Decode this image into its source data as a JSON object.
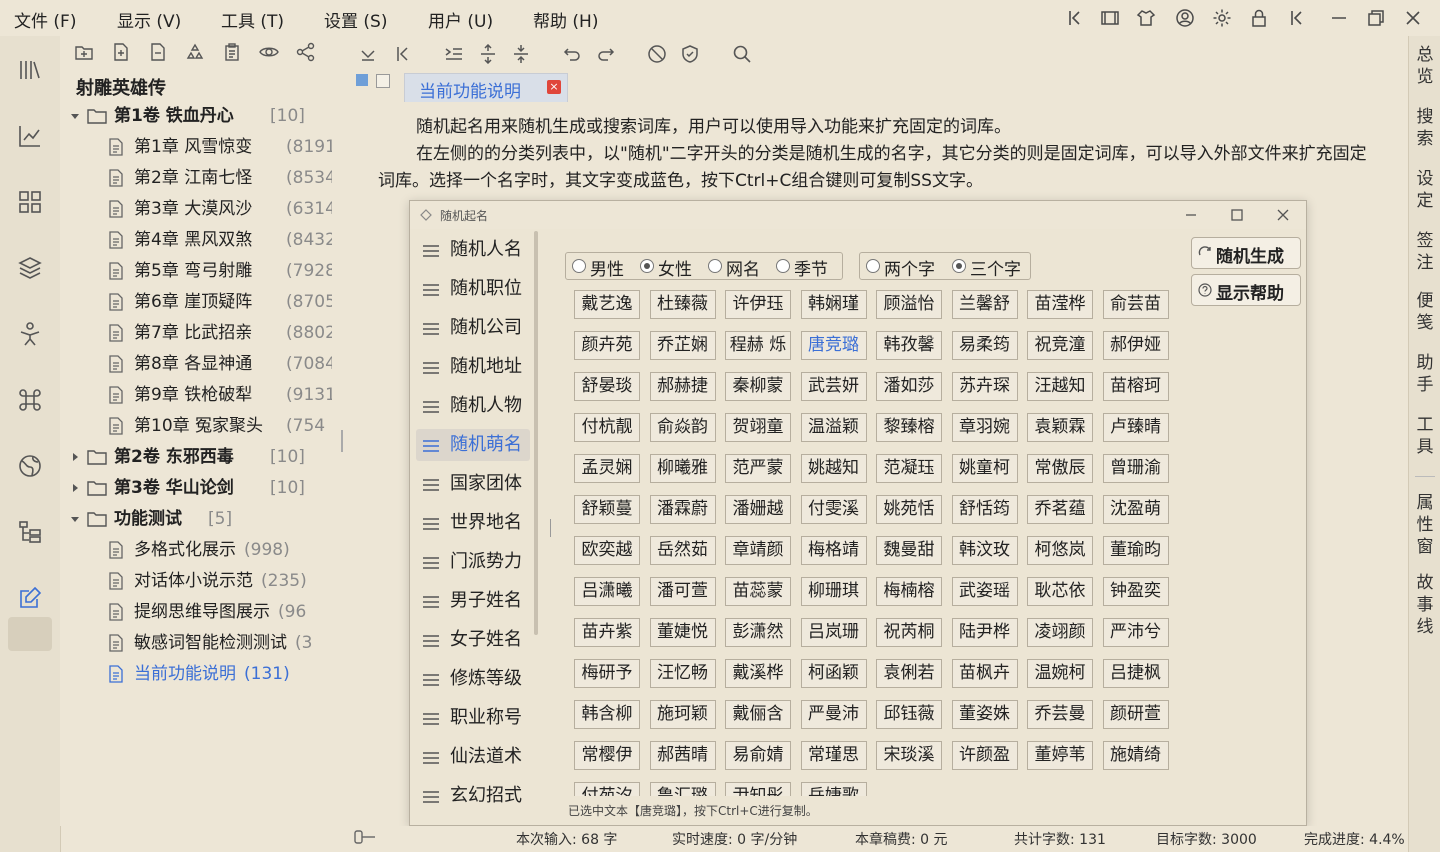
{
  "menubar": {
    "items": [
      {
        "label": "文件 (F)"
      },
      {
        "label": "显示 (V)"
      },
      {
        "label": "工具 (T)"
      },
      {
        "label": "设置 (S)"
      },
      {
        "label": "用户 (U)"
      },
      {
        "label": "帮助 (H)"
      }
    ]
  },
  "tree": {
    "title": "射雕英雄传",
    "volume1": {
      "label": "第1卷 铁血丹心",
      "count": "[10]"
    },
    "chapters": [
      {
        "label": "第1章 风雪惊变",
        "count": "(8191"
      },
      {
        "label": "第2章 江南七怪",
        "count": "(8534"
      },
      {
        "label": "第3章 大漠风沙",
        "count": "(6314"
      },
      {
        "label": "第4章 黑风双煞",
        "count": "(8432"
      },
      {
        "label": "第5章 弯弓射雕",
        "count": "(7928"
      },
      {
        "label": "第6章 崖顶疑阵",
        "count": "(8705"
      },
      {
        "label": "第7章 比武招亲",
        "count": "(8802"
      },
      {
        "label": "第8章 各显神通",
        "count": "(7084"
      },
      {
        "label": "第9章 铁枪破犁",
        "count": "(9131"
      },
      {
        "label": "第10章 冤家聚头",
        "count": "(754"
      }
    ],
    "volume2": {
      "label": "第2卷 东邪西毒",
      "count": "[10]"
    },
    "volume3": {
      "label": "第3卷 华山论剑",
      "count": "[10]"
    },
    "test_folder": {
      "label": "功能测试",
      "count": "[5]"
    },
    "test_items": [
      {
        "label": "多格式化展示",
        "count": "(998)"
      },
      {
        "label": "对话体小说示范",
        "count": "(235)"
      },
      {
        "label": "提纲思维导图展示",
        "count": "(96"
      },
      {
        "label": "敏感词智能检测测试",
        "count": "(3"
      },
      {
        "label": "当前功能说明",
        "count": "(131)"
      }
    ]
  },
  "editor": {
    "tab_label": "当前功能说明",
    "tab_close": "×",
    "paragraph1": "随机起名用来随机生成或搜索词库，用户可以使用导入功能来扩充固定的词库。",
    "paragraph2": "在左侧的的分类列表中，以\"随机\"二字开头的分类是随机生成的名字，其它分类的则是固定词库，可以导入外部文件来扩充固定词库。选择一个名字时，其文字变成蓝色，按下Ctrl+C组合键则可复制SS文字。"
  },
  "dialog": {
    "title": "随机起名",
    "categories": [
      {
        "label": "随机人名"
      },
      {
        "label": "随机职位"
      },
      {
        "label": "随机公司"
      },
      {
        "label": "随机地址"
      },
      {
        "label": "随机人物"
      },
      {
        "label": "随机萌名"
      },
      {
        "label": "国家团体"
      },
      {
        "label": "世界地名"
      },
      {
        "label": "门派势力"
      },
      {
        "label": "男子姓名"
      },
      {
        "label": "女子姓名"
      },
      {
        "label": "修炼等级"
      },
      {
        "label": "职业称号"
      },
      {
        "label": "仙法道术"
      },
      {
        "label": "玄幻招式"
      }
    ],
    "type_options": [
      {
        "label": "男性",
        "checked": false
      },
      {
        "label": "女性",
        "checked": true
      },
      {
        "label": "网名",
        "checked": false
      },
      {
        "label": "季节",
        "checked": false
      }
    ],
    "length_options": [
      {
        "label": "两个字",
        "checked": false
      },
      {
        "label": "三个字",
        "checked": true
      }
    ],
    "generate_label": "随机生成",
    "help_label": "显示帮助",
    "names": [
      [
        "戴艺逸",
        "杜臻薇",
        "许伊珏",
        "韩娴瑾",
        "顾溢怡",
        "兰馨舒",
        "苗滢桦",
        "俞芸苗"
      ],
      [
        "颜卉苑",
        "乔芷娴",
        "程赫 烁",
        "唐竞璐",
        "韩孜馨",
        "易柔筠",
        "祝竞潼",
        "郝伊娅"
      ],
      [
        "舒晏琰",
        "郝赫捷",
        "秦柳蒙",
        "武芸妍",
        "潘如莎",
        "苏卉琛",
        "汪越知",
        "苗榕珂"
      ],
      [
        "付杭靓",
        "俞焱韵",
        "贺翊童",
        "温溢颖",
        "黎臻榕",
        "章羽婉",
        "袁颖霖",
        "卢臻晴"
      ],
      [
        "孟灵娴",
        "柳曦雅",
        "范严蒙",
        "姚越知",
        "范凝珏",
        "姚童柯",
        "常傲辰",
        "曾珊渝"
      ],
      [
        "舒颖蔓",
        "潘霖蔚",
        "潘姗越",
        "付雯溪",
        "姚苑恬",
        "舒恬筠",
        "乔茗蕴",
        "沈盈萌"
      ],
      [
        "欧奕越",
        "岳然茹",
        "章靖颜",
        "梅格靖",
        "魏曼甜",
        "韩汶玫",
        "柯悠岚",
        "董瑜昀"
      ],
      [
        "吕潇曦",
        "潘可萱",
        "苗蕊蒙",
        "柳珊琪",
        "梅楠榕",
        "武姿瑶",
        "耿芯依",
        "钟盈奕"
      ],
      [
        "苗卉紫",
        "董婕悦",
        "彭潇然",
        "吕岚珊",
        "祝芮桐",
        "陆尹桦",
        "凌翊颜",
        "严沛兮"
      ],
      [
        "梅研予",
        "汪忆畅",
        "戴溪桦",
        "柯函颖",
        "袁俐若",
        "苗枫卉",
        "温婉柯",
        "吕捷枫"
      ],
      [
        "韩含柳",
        "施珂颖",
        "戴俪含",
        "严曼沛",
        "邱钰薇",
        "董姿姝",
        "乔芸曼",
        "颜研萱"
      ],
      [
        "常樱伊",
        "郝茜晴",
        "易俞婧",
        "常瑾思",
        "宋琰溪",
        "许颜盈",
        "董婷苇",
        "施婧绮"
      ],
      [
        "付苑汐",
        "鲁汇璐",
        "尹知彤",
        "岳婕歌",
        "",
        "",
        "",
        ""
      ]
    ],
    "selected_name": "唐竞璐",
    "status": "已选中文本【唐竞璐】，按下Ctrl+C进行复制。"
  },
  "right_rail": {
    "items": [
      {
        "label": "总览"
      },
      {
        "label": "搜索"
      },
      {
        "label": "设定"
      },
      {
        "label": "签注"
      },
      {
        "label": "便笺"
      },
      {
        "label": "助手"
      },
      {
        "label": "工具"
      },
      {
        "label": "属性窗"
      },
      {
        "label": "故事线"
      }
    ]
  },
  "statusbar": {
    "input": "本次输入:  68  字",
    "speed": "实时速度:  0 字/分钟",
    "fee": "本章稿费:  0 元",
    "total": "共计字数:  131",
    "target": "目标字数: 3000",
    "progress": "完成进度: 4.4%"
  },
  "colors": {
    "background": "#ede6d6",
    "accent_blue": "#3b6fd6",
    "close_red": "#e0463a"
  }
}
